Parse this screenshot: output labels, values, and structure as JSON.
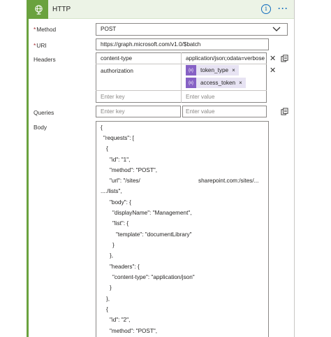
{
  "header": {
    "title": "HTTP",
    "icon": "globe-icon",
    "accent_color": "#6aa23e"
  },
  "method": {
    "label": "Method",
    "required": "*",
    "value": "POST"
  },
  "uri": {
    "label": "URI",
    "required": "*",
    "value": "https://graph.microsoft.com/v1.0/$batch"
  },
  "headers": {
    "label": "Headers",
    "rows": [
      {
        "key": "content-type",
        "value": "application/json;odata=verbose"
      },
      {
        "key": "authorization",
        "tokens": [
          "token_type",
          "access_token"
        ]
      }
    ],
    "key_placeholder": "Enter key",
    "value_placeholder": "Enter value",
    "token_glyph": "{x}",
    "token_close": "×",
    "remove_glyph": "✕"
  },
  "queries": {
    "label": "Queries",
    "key_placeholder": "Enter key",
    "value_placeholder": "Enter value"
  },
  "body": {
    "label": "Body",
    "lines": [
      "{",
      "\"requests\": [",
      "{",
      "\"id\": \"1\",",
      "\"method\": \"POST\",",
      "\"url\": \"/sites/",
      "sharepoint.com:/sites/...",
      "..../lists\",",
      "\"body\": {",
      "\"displayName\": \"Management\",",
      "\"list\": {",
      "\"template\": \"documentLibrary\"",
      "}",
      "},",
      "\"headers\": {",
      "\"content-type\": \"application/json\"",
      "}",
      "},",
      "{",
      "\"id\": \"2\",",
      "\"method\": \"POST\","
    ]
  }
}
